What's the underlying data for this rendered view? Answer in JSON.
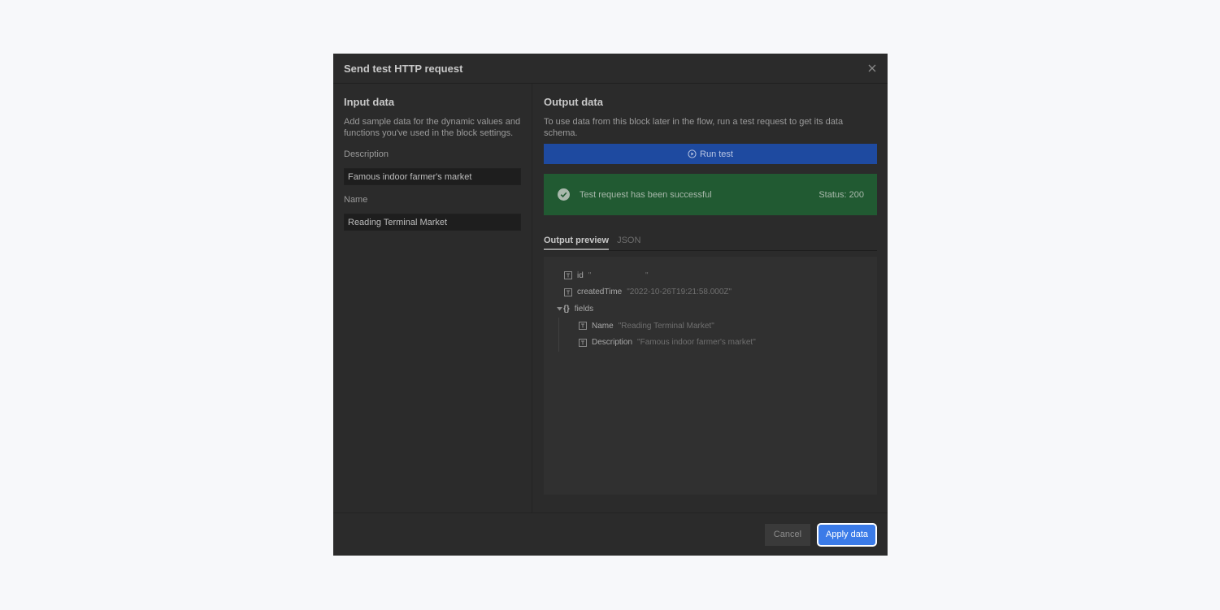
{
  "modal": {
    "title": "Send test HTTP request",
    "close_icon": "close-icon"
  },
  "input_panel": {
    "title": "Input data",
    "description": "Add sample data for the dynamic values and functions you've used in the block settings.",
    "fields": [
      {
        "label": "Description",
        "value": "Famous indoor farmer's market"
      },
      {
        "label": "Name",
        "value": "Reading Terminal Market"
      }
    ]
  },
  "output_panel": {
    "title": "Output data",
    "description": "To use data from this block later in the flow, run a test request to get its data schema.",
    "run_button": {
      "label": "Run test",
      "icon": "play-circle-icon"
    },
    "banner": {
      "icon": "check-circle-icon",
      "message": "Test request has been successful",
      "status": "Status: 200"
    },
    "tabs": [
      {
        "label": "Output preview",
        "active": true
      },
      {
        "label": "JSON",
        "active": false
      }
    ],
    "preview": {
      "rows": [
        {
          "key": "id",
          "value": "\"                        \""
        },
        {
          "key": "createdTime",
          "value": "\"2022-10-26T19:21:58.000Z\""
        }
      ],
      "group": {
        "key": "fields",
        "icon": "braces-icon",
        "children": [
          {
            "key": "Name",
            "value": "\"Reading Terminal Market\""
          },
          {
            "key": "Description",
            "value": "\"Famous indoor farmer's market\""
          }
        ]
      }
    }
  },
  "footer": {
    "cancel_label": "Cancel",
    "apply_label": "Apply data"
  },
  "colors": {
    "page_bg": "#f7f8fa",
    "modal_bg": "#2b2b2b",
    "run_button_bg": "#1e4aa0",
    "success_bg": "#215a32",
    "apply_bg": "#3b7be8"
  }
}
